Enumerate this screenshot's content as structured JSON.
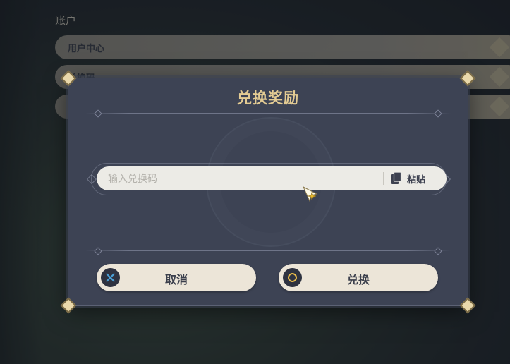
{
  "background": {
    "section_title": "账户",
    "rows": [
      {
        "label": "用户中心"
      },
      {
        "label": "兑换码"
      },
      {
        "label": ""
      }
    ]
  },
  "dialog": {
    "title": "兑换奖励",
    "input": {
      "placeholder": "输入兑换码",
      "value": ""
    },
    "paste_label": "粘贴",
    "cancel_label": "取消",
    "confirm_label": "兑换"
  },
  "colors": {
    "title": "#e3cb93",
    "dialog_bg": "#3d4354",
    "button_bg": "#ece5d8",
    "confirm_icon_ring": "#e6b94a",
    "cancel_icon_x": "#4a9fd6"
  },
  "icons": {
    "paste": "clipboard-icon",
    "cancel": "cross-button-icon",
    "confirm": "circle-button-icon",
    "cursor": "star-cursor-icon"
  }
}
